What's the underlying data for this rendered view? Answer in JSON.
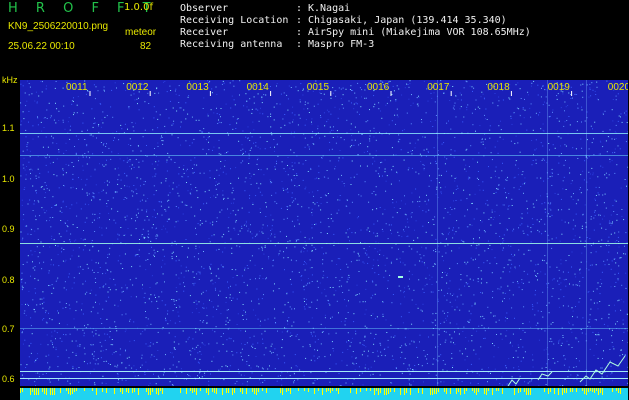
{
  "header": {
    "app_title": "H R O F F T",
    "version": "1.0.0f",
    "filename": "KN9_2506220010.png",
    "mode": "meteor",
    "datetime": "25.06.22 00:10",
    "count": "82"
  },
  "info": [
    {
      "label": "Observer",
      "value": "K.Nagai"
    },
    {
      "label": "Receiving Location",
      "value": "Chigasaki, Japan (139.414 35.340)"
    },
    {
      "label": "Receiver",
      "value": "AirSpy mini (Miakejima VOR 108.65MHz)"
    },
    {
      "label": "Receiving antenna",
      "value": "Maspro FM-3"
    }
  ],
  "info_separator": ":",
  "axis": {
    "y_unit": "kHz",
    "y_ticks": [
      "1.1",
      "1.0",
      "0.9",
      "0.8",
      "0.7",
      "0.6"
    ],
    "x_ticks": [
      "0011",
      "0012",
      "0013",
      "0014",
      "0015",
      "0016",
      "0017",
      "0018",
      "0019",
      "0020"
    ]
  },
  "colors": {
    "background": "#000000",
    "spectrum_bg": "#1a1fb8",
    "noise": "#4a7cff",
    "signal": "#7ff0e0",
    "label_yellow": "#e8e800",
    "title_green": "#22c24a",
    "bottom_bar": "#21d3f0"
  }
}
